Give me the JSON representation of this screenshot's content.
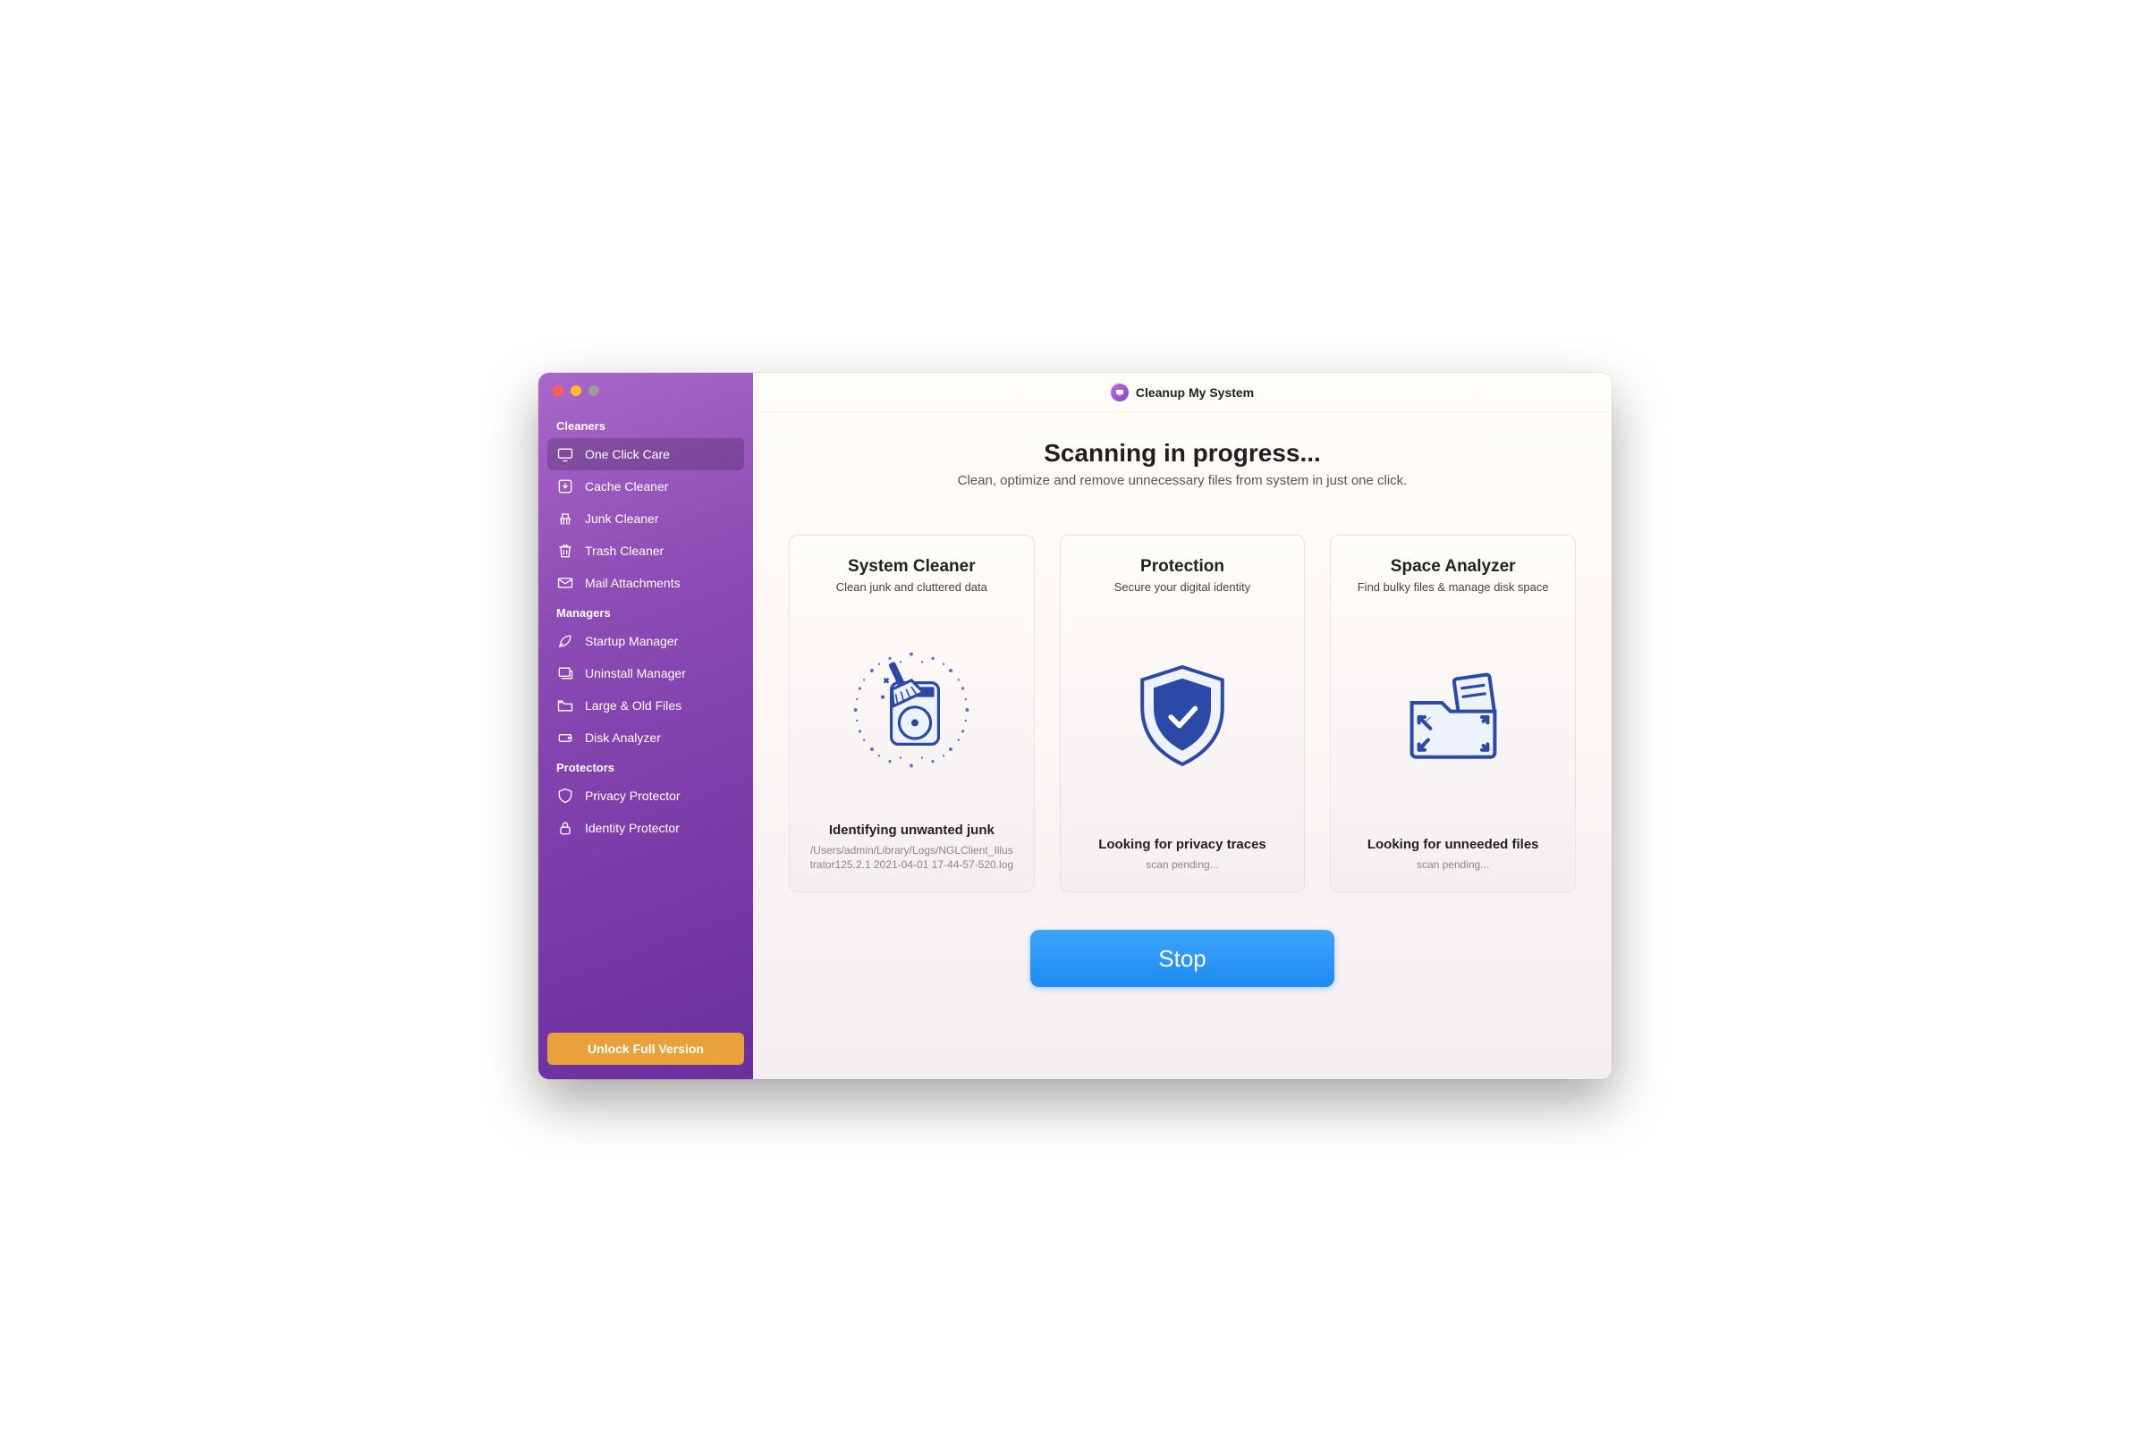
{
  "app": {
    "title": "Cleanup My System"
  },
  "sidebar": {
    "sections": {
      "cleaners": {
        "label": "Cleaners",
        "items": [
          {
            "label": "One Click Care"
          },
          {
            "label": "Cache Cleaner"
          },
          {
            "label": "Junk Cleaner"
          },
          {
            "label": "Trash Cleaner"
          },
          {
            "label": "Mail Attachments"
          }
        ]
      },
      "managers": {
        "label": "Managers",
        "items": [
          {
            "label": "Startup Manager"
          },
          {
            "label": "Uninstall Manager"
          },
          {
            "label": "Large & Old Files"
          },
          {
            "label": "Disk Analyzer"
          }
        ]
      },
      "protectors": {
        "label": "Protectors",
        "items": [
          {
            "label": "Privacy Protector"
          },
          {
            "label": "Identity Protector"
          }
        ]
      }
    },
    "unlock_label": "Unlock Full Version"
  },
  "main": {
    "headline": "Scanning in progress...",
    "subhead": "Clean, optimize and remove unnecessary files from system in just one click.",
    "cards": {
      "system_cleaner": {
        "title": "System Cleaner",
        "sub": "Clean junk and cluttered data",
        "status": "Identifying unwanted junk",
        "detail": "/Users/admin/Library/Logs/NGLClient_Illustrator125.2.1 2021-04-01 17-44-57-520.log"
      },
      "protection": {
        "title": "Protection",
        "sub": "Secure your digital identity",
        "status": "Looking for privacy traces",
        "detail": "scan pending..."
      },
      "space_analyzer": {
        "title": "Space Analyzer",
        "sub": "Find bulky files & manage disk space",
        "status": "Looking for unneeded files",
        "detail": "scan pending..."
      }
    },
    "stop_label": "Stop"
  }
}
